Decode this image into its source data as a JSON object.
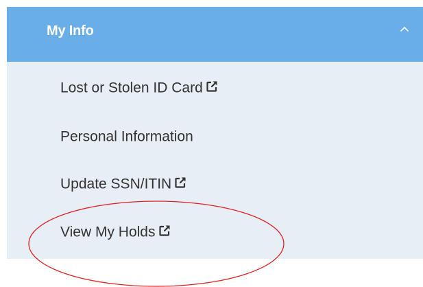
{
  "panel": {
    "title": "My Info",
    "header_color": "#6aaee8",
    "body_color": "#e8eef5",
    "collapse_icon": "chevron-up-icon"
  },
  "menu": {
    "items": [
      {
        "label": "Lost or Stolen ID Card",
        "external": true,
        "icon": "external-link-icon"
      },
      {
        "label": "Personal Information",
        "external": false
      },
      {
        "label": "Update SSN/ITIN",
        "external": true,
        "icon": "external-link-icon"
      },
      {
        "label": "View My Holds",
        "external": true,
        "icon": "external-link-icon"
      }
    ]
  },
  "annotation": {
    "shape": "ellipse",
    "color": "#e02020",
    "target": "View My Holds"
  }
}
